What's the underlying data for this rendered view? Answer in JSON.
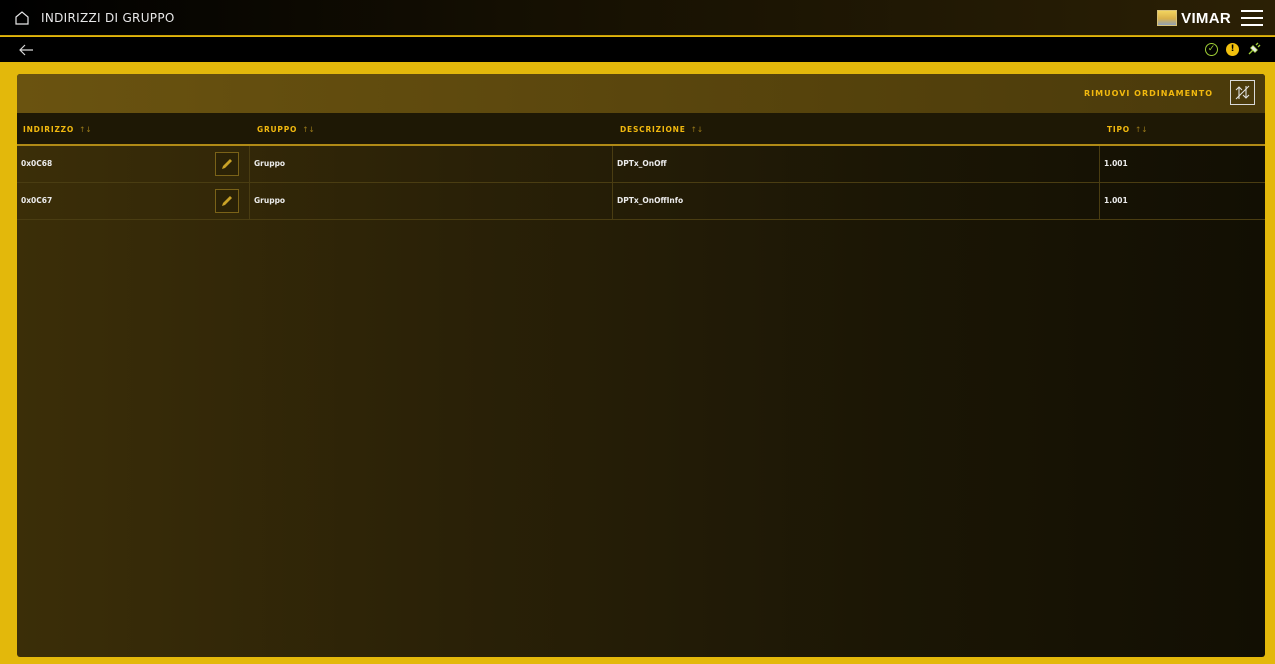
{
  "header": {
    "title": "INDIRIZZI DI GRUPPO",
    "brand": "VIMAR"
  },
  "icons": {
    "home": "home-icon",
    "menu": "hamburger-menu-icon",
    "back": "back-arrow-icon",
    "status_ok": "check-circle-icon",
    "status_warning": "warning-icon",
    "connection": "plug-icon",
    "edit": "pencil-icon",
    "remove_sort": "remove-sort-icon"
  },
  "colors": {
    "accent": "#e3b80b",
    "header_text": "#f2b90f",
    "ok": "#9fcf36",
    "warning": "#f2c10e"
  },
  "toolbar": {
    "remove_sort_label": "RIMUOVI ORDINAMENTO"
  },
  "table": {
    "columns": [
      "INDIRIZZO",
      "GRUPPO",
      "DESCRIZIONE",
      "TIPO"
    ],
    "sort_glyph": "↑↓",
    "rows": [
      {
        "indirizzo": "0x0C68",
        "gruppo": "Gruppo",
        "descrizione": "DPTx_OnOff",
        "tipo": "1.001"
      },
      {
        "indirizzo": "0x0C67",
        "gruppo": "Gruppo",
        "descrizione": "DPTx_OnOffInfo",
        "tipo": "1.001"
      }
    ]
  }
}
